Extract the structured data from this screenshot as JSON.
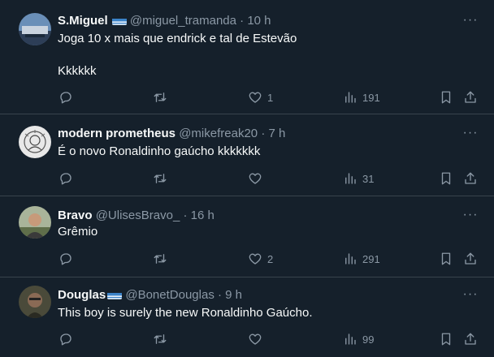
{
  "tweets": [
    {
      "name": "S.Miguel",
      "handle": "@miguel_tramanda",
      "time": "10 h",
      "text": "Joga 10 x mais que endrick e tal de Estevão\n\nKkkkkk",
      "replies": "",
      "retweets": "",
      "likes": "1",
      "views": "191",
      "has_flag": true
    },
    {
      "name": "modern prometheus",
      "handle": "@mikefreak20",
      "time": "7 h",
      "text": "É o novo Ronaldinho gaúcho kkkkkkk",
      "replies": "",
      "retweets": "",
      "likes": "",
      "views": "31",
      "has_flag": false
    },
    {
      "name": "Bravo",
      "handle": "@UlisesBravo_",
      "time": "16 h",
      "text": "Grêmio",
      "replies": "",
      "retweets": "",
      "likes": "2",
      "views": "291",
      "has_flag": false
    },
    {
      "name": "Douglas",
      "handle": "@BonetDouglas",
      "time": "9 h",
      "text": "This boy is surely the new Ronaldinho Gaúcho.",
      "replies": "",
      "retweets": "",
      "likes": "",
      "views": "99",
      "has_flag": true
    }
  ],
  "separator": "·",
  "more_label": "···",
  "colors": {
    "background": "#15202b",
    "text": "#f7f9f9",
    "muted": "#8b98a5",
    "divider": "#38444d",
    "flag_blue": "#3b83c9"
  },
  "icons": [
    "reply-icon",
    "retweet-icon",
    "like-icon",
    "views-icon",
    "bookmark-icon",
    "share-icon",
    "more-icon"
  ]
}
